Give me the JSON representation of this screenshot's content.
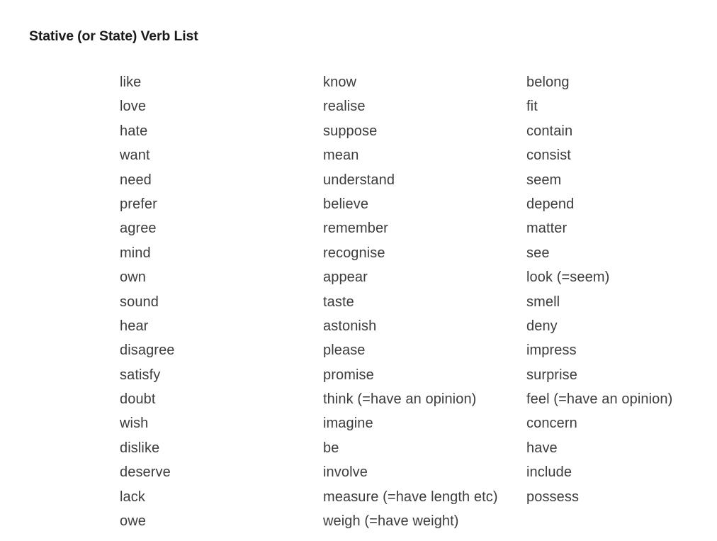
{
  "page": {
    "title": "Stative (or State) Verb List",
    "background_color": "#ffffff",
    "title_color": "#1a1a1a",
    "text_color": "#3d3d3d"
  },
  "columns": [
    {
      "id": "column-1",
      "items": [
        "like",
        "love",
        "hate",
        "want",
        "need",
        "prefer",
        "agree",
        "mind",
        "own",
        "sound",
        "hear",
        "disagree",
        "satisfy",
        "doubt",
        "wish",
        "dislike",
        "deserve",
        "lack",
        "owe"
      ]
    },
    {
      "id": "column-2",
      "items": [
        "know",
        "realise",
        "suppose",
        "mean",
        "understand",
        "believe",
        "remember",
        "recognise",
        "appear",
        "taste",
        "astonish",
        "please",
        "promise",
        "think (=have an opinion)",
        "imagine",
        "be",
        "involve",
        "measure (=have length etc)",
        "weigh (=have weight)"
      ]
    },
    {
      "id": "column-3",
      "items": [
        "belong",
        "fit",
        "contain",
        "consist",
        "seem",
        "depend",
        "matter",
        "see",
        "look (=seem)",
        "smell",
        "deny",
        "impress",
        "surprise",
        "feel (=have an opinion)",
        "concern",
        "have",
        "include",
        "possess"
      ]
    }
  ]
}
